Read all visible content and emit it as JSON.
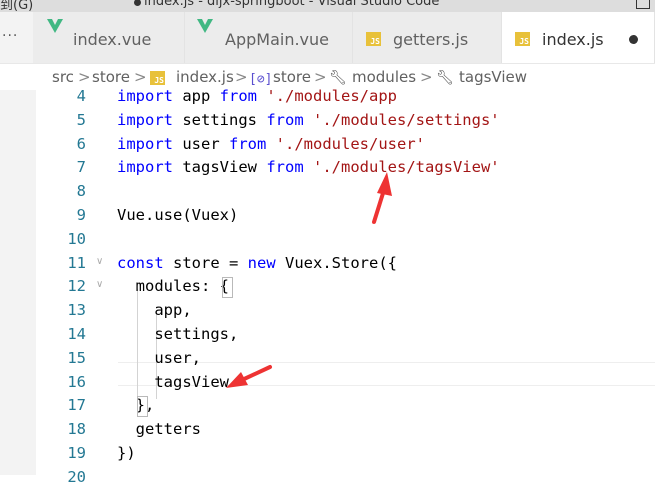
{
  "window": {
    "menu_fragment": "到(G)",
    "title": "index.js - dijx-springboot - Visual Studio Code"
  },
  "tabs": [
    {
      "label": "index.vue",
      "icon": "vue-icon",
      "active": false
    },
    {
      "label": "AppMain.vue",
      "icon": "vue-icon",
      "active": false
    },
    {
      "label": "getters.js",
      "icon": "js-file-icon",
      "active": false
    },
    {
      "label": "index.js",
      "icon": "js-file-icon",
      "active": true,
      "dirty": true
    }
  ],
  "tab_overflow": "···",
  "breadcrumb": {
    "items": [
      "src",
      "store",
      "index.js",
      "store",
      "modules",
      "tagsView"
    ],
    "separator": ">"
  },
  "js_badge": "JS",
  "editor": {
    "lines": [
      {
        "n": "4",
        "text": "import app from './modules/app"
      },
      {
        "n": "5",
        "text": "import settings from './modules/settings'"
      },
      {
        "n": "6",
        "text": "import user from './modules/user'"
      },
      {
        "n": "7",
        "text": "import tagsView from './modules/tagsView'"
      },
      {
        "n": "8",
        "text": ""
      },
      {
        "n": "9",
        "text": "Vue.use(Vuex)"
      },
      {
        "n": "10",
        "text": ""
      },
      {
        "n": "11",
        "text": "const store = new Vuex.Store({"
      },
      {
        "n": "12",
        "text": "  modules: {"
      },
      {
        "n": "13",
        "text": "    app,"
      },
      {
        "n": "14",
        "text": "    settings,"
      },
      {
        "n": "15",
        "text": "    user,"
      },
      {
        "n": "16",
        "text": "    tagsView"
      },
      {
        "n": "17",
        "text": "  },"
      },
      {
        "n": "18",
        "text": "  getters"
      },
      {
        "n": "19",
        "text": "})"
      },
      {
        "n": "20",
        "text": ""
      }
    ]
  },
  "colors": {
    "keyword": "#0000ff",
    "string": "#a31515",
    "line_number": "#237893",
    "annotation_arrow": "#ee3333"
  }
}
